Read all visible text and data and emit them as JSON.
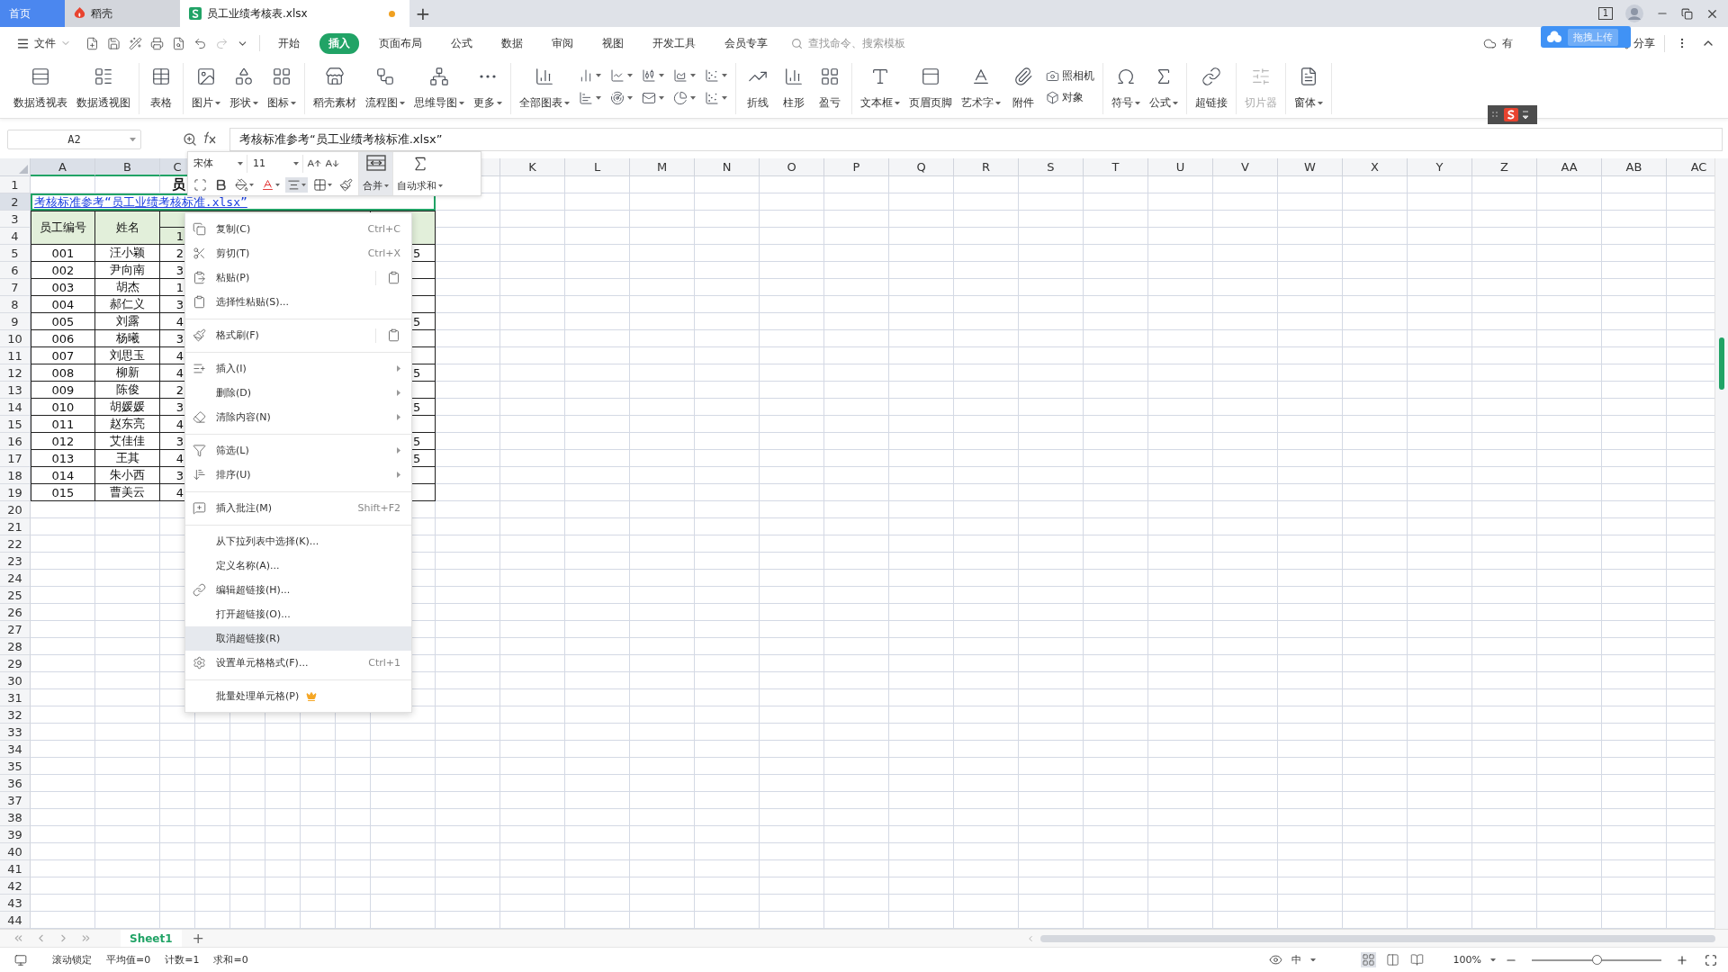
{
  "tabs": [
    {
      "label": "首页",
      "kind": "home",
      "selected": false,
      "unsaved": false
    },
    {
      "label": "稻壳",
      "kind": "docer",
      "selected": false,
      "unsaved": false
    },
    {
      "label": "员工业绩考核表.xlsx",
      "kind": "sheet",
      "selected": true,
      "unsaved": true
    }
  ],
  "new_tab": "+",
  "window_count": "1",
  "file_menu": "文件",
  "menu_tabs": [
    {
      "label": "开始",
      "selected": false
    },
    {
      "label": "插入",
      "selected": true
    },
    {
      "label": "页面布局",
      "selected": false
    },
    {
      "label": "公式",
      "selected": false
    },
    {
      "label": "数据",
      "selected": false
    },
    {
      "label": "审阅",
      "selected": false
    },
    {
      "label": "视图",
      "selected": false
    },
    {
      "label": "开发工具",
      "selected": false
    },
    {
      "label": "会员专享",
      "selected": false
    }
  ],
  "search": {
    "placeholder": "查找命令、搜索模板"
  },
  "cloud_status": "有",
  "upload_bubble": "拖拽上传",
  "share": "分享",
  "ribbon": [
    {
      "items": [
        {
          "kind": "large",
          "label": "数据透视表",
          "dropdown": false,
          "disabled": false
        },
        {
          "kind": "large",
          "label": "数据透视图",
          "dropdown": false,
          "disabled": false
        }
      ]
    },
    {
      "items": [
        {
          "kind": "large",
          "label": "表格",
          "dropdown": false,
          "disabled": false
        }
      ]
    },
    {
      "items": [
        {
          "kind": "large",
          "label": "图片",
          "dropdown": true,
          "disabled": false
        },
        {
          "kind": "large",
          "label": "形状",
          "dropdown": true,
          "disabled": false
        },
        {
          "kind": "large",
          "label": "图标",
          "dropdown": true,
          "disabled": false
        }
      ]
    },
    {
      "items": [
        {
          "kind": "large",
          "label": "稻壳素材",
          "dropdown": false,
          "disabled": false
        },
        {
          "kind": "large",
          "label": "流程图",
          "dropdown": true,
          "disabled": false
        },
        {
          "kind": "large",
          "label": "思维导图",
          "dropdown": true,
          "disabled": false
        },
        {
          "kind": "large",
          "label": "更多",
          "dropdown": true,
          "disabled": false
        }
      ]
    },
    {
      "items": [
        {
          "kind": "large",
          "label": "全部图表",
          "dropdown": true,
          "disabled": false
        },
        {
          "kind": "icon",
          "dropdown": true,
          "disabled": false
        },
        {
          "kind": "icon",
          "dropdown": true,
          "disabled": false
        },
        {
          "kind": "icon",
          "dropdown": true,
          "disabled": false
        },
        {
          "kind": "icon",
          "dropdown": true,
          "disabled": false
        },
        {
          "kind": "icon",
          "dropdown": true,
          "disabled": false
        },
        {
          "kind": "icon",
          "dropdown": true,
          "disabled": false
        },
        {
          "kind": "icon",
          "dropdown": true,
          "disabled": false
        },
        {
          "kind": "icon",
          "dropdown": true,
          "disabled": false
        },
        {
          "kind": "icon",
          "dropdown": true,
          "disabled": false
        },
        {
          "kind": "icon",
          "dropdown": true,
          "disabled": false
        }
      ]
    },
    {
      "items": [
        {
          "kind": "large",
          "label": "折线",
          "dropdown": false,
          "disabled": false
        },
        {
          "kind": "large",
          "label": "柱形",
          "dropdown": false,
          "disabled": false
        },
        {
          "kind": "large",
          "label": "盈亏",
          "dropdown": false,
          "disabled": false
        }
      ]
    },
    {
      "items": [
        {
          "kind": "large",
          "label": "文本框",
          "dropdown": true,
          "disabled": false
        },
        {
          "kind": "large",
          "label": "页眉页脚",
          "dropdown": false,
          "disabled": false
        },
        {
          "kind": "large",
          "label": "艺术字",
          "dropdown": true,
          "disabled": false
        },
        {
          "kind": "large",
          "label": "附件",
          "dropdown": false,
          "disabled": false
        },
        {
          "kind": "small",
          "label": "照相机",
          "dropdown": false,
          "disabled": false
        },
        {
          "kind": "small",
          "label": "对象",
          "dropdown": false,
          "disabled": false
        }
      ]
    },
    {
      "items": [
        {
          "kind": "large",
          "label": "符号",
          "dropdown": true,
          "disabled": false
        },
        {
          "kind": "large",
          "label": "公式",
          "dropdown": true,
          "disabled": false
        }
      ]
    },
    {
      "items": [
        {
          "kind": "large",
          "label": "超链接",
          "dropdown": false,
          "disabled": false
        }
      ]
    },
    {
      "items": [
        {
          "kind": "large",
          "label": "切片器",
          "dropdown": false,
          "disabled": true
        }
      ]
    },
    {
      "items": [
        {
          "kind": "large",
          "label": "窗体",
          "dropdown": true,
          "disabled": false
        }
      ]
    }
  ],
  "formula_bar": {
    "name_box": "A2",
    "formula": "考核标准参考“员工业绩考核标准.xlsx”"
  },
  "mini_toolbar": {
    "font": "宋体",
    "size": "11",
    "merge": {
      "label": "合并",
      "selected": true
    },
    "autosum": {
      "label": "自动求和",
      "selected": false
    },
    "format_buttons": [
      {
        "selected": false
      },
      {
        "selected": false
      },
      {
        "selected": false
      },
      {
        "selected": false
      },
      {
        "selected": true
      },
      {
        "selected": false
      },
      {
        "selected": false
      }
    ]
  },
  "sheet": {
    "column_headers": [
      {
        "label": "A",
        "selected": true
      },
      {
        "label": "B",
        "selected": true
      },
      {
        "label": "C",
        "selected": true
      },
      {
        "label": "K",
        "selected": false
      },
      {
        "label": "L",
        "selected": false
      },
      {
        "label": "M",
        "selected": false
      },
      {
        "label": "N",
        "selected": false
      },
      {
        "label": "O",
        "selected": false
      },
      {
        "label": "P",
        "selected": false
      },
      {
        "label": "Q",
        "selected": false
      },
      {
        "label": "R",
        "selected": false
      },
      {
        "label": "S",
        "selected": false
      },
      {
        "label": "T",
        "selected": false
      },
      {
        "label": "U",
        "selected": false
      },
      {
        "label": "V",
        "selected": false
      },
      {
        "label": "W",
        "selected": false
      },
      {
        "label": "X",
        "selected": false
      },
      {
        "label": "Y",
        "selected": false
      },
      {
        "label": "Z",
        "selected": false
      },
      {
        "label": "AA",
        "selected": false
      },
      {
        "label": "AB",
        "selected": false
      },
      {
        "label": "AC",
        "selected": false
      }
    ],
    "row_headers": [
      {
        "label": "1",
        "selected": false
      },
      {
        "label": "2",
        "selected": true
      },
      {
        "label": "3",
        "selected": false
      },
      {
        "label": "4",
        "selected": false
      },
      {
        "label": "5",
        "selected": false
      },
      {
        "label": "6",
        "selected": false
      },
      {
        "label": "7",
        "selected": false
      },
      {
        "label": "8",
        "selected": false
      },
      {
        "label": "9",
        "selected": false
      },
      {
        "label": "10",
        "selected": false
      },
      {
        "label": "11",
        "selected": false
      },
      {
        "label": "12",
        "selected": false
      },
      {
        "label": "13",
        "selected": false
      },
      {
        "label": "14",
        "selected": false
      },
      {
        "label": "15",
        "selected": false
      },
      {
        "label": "16",
        "selected": false
      },
      {
        "label": "17",
        "selected": false
      },
      {
        "label": "18",
        "selected": false
      },
      {
        "label": "19",
        "selected": false
      },
      {
        "label": "20",
        "selected": false
      },
      {
        "label": "21",
        "selected": false
      },
      {
        "label": "22",
        "selected": false
      },
      {
        "label": "23",
        "selected": false
      },
      {
        "label": "24",
        "selected": false
      },
      {
        "label": "25",
        "selected": false
      },
      {
        "label": "26",
        "selected": false
      },
      {
        "label": "27",
        "selected": false
      },
      {
        "label": "28",
        "selected": false
      },
      {
        "label": "29",
        "selected": false
      },
      {
        "label": "30",
        "selected": false
      },
      {
        "label": "31",
        "selected": false
      },
      {
        "label": "32",
        "selected": false
      },
      {
        "label": "33",
        "selected": false
      },
      {
        "label": "34",
        "selected": false
      },
      {
        "label": "35",
        "selected": false
      },
      {
        "label": "36",
        "selected": false
      },
      {
        "label": "37",
        "selected": false
      },
      {
        "label": "38",
        "selected": false
      },
      {
        "label": "39",
        "selected": false
      },
      {
        "label": "40",
        "selected": false
      },
      {
        "label": "41",
        "selected": false
      },
      {
        "label": "42",
        "selected": false
      },
      {
        "label": "43",
        "selected": false
      },
      {
        "label": "44",
        "selected": false
      }
    ],
    "title": "员",
    "link": "考核标准参考“员工业绩考核标准.xlsx”",
    "header": {
      "employee_id": "员工编号",
      "name": "姓名",
      "column_3": "1"
    },
    "rows": [
      {
        "employee_id": "001",
        "name": "汪小颖",
        "column_3": "2",
        "column_9": "5"
      },
      {
        "employee_id": "002",
        "name": "尹向南",
        "column_3": "3"
      },
      {
        "employee_id": "003",
        "name": "胡杰",
        "column_3": "1"
      },
      {
        "employee_id": "004",
        "name": "郝仁义",
        "column_3": "3"
      },
      {
        "employee_id": "005",
        "name": "刘露",
        "column_3": "4",
        "column_9": "5"
      },
      {
        "employee_id": "006",
        "name": "杨曦",
        "column_3": "3"
      },
      {
        "employee_id": "007",
        "name": "刘思玉",
        "column_3": "4"
      },
      {
        "employee_id": "008",
        "name": "柳新",
        "column_3": "4",
        "column_9": "5"
      },
      {
        "employee_id": "009",
        "name": "陈俊",
        "column_3": "2"
      },
      {
        "employee_id": "010",
        "name": "胡媛媛",
        "column_3": "3",
        "column_9": "5"
      },
      {
        "employee_id": "011",
        "name": "赵东亮",
        "column_3": "4"
      },
      {
        "employee_id": "012",
        "name": "艾佳佳",
        "column_3": "3",
        "column_9": "5"
      },
      {
        "employee_id": "013",
        "name": "王其",
        "column_3": "4",
        "column_9": "5"
      },
      {
        "employee_id": "014",
        "name": "朱小西",
        "column_3": "3"
      },
      {
        "employee_id": "015",
        "name": "曹美云",
        "column_3": "4"
      }
    ]
  },
  "context_menu": {
    "groups": [
      [
        {
          "label": "复制(C)",
          "shortcut": "Ctrl+C",
          "submenu": false,
          "selected": false
        },
        {
          "label": "剪切(T)",
          "shortcut": "Ctrl+X",
          "submenu": false,
          "selected": false
        },
        {
          "label": "粘贴(P)",
          "submenu": false,
          "side_button": true,
          "selected": false
        },
        {
          "label": "选择性粘贴(S)...",
          "submenu": false,
          "selected": false
        }
      ],
      [
        {
          "label": "格式刷(F)",
          "submenu": false,
          "side_button": true,
          "selected": false
        }
      ],
      [
        {
          "label": "插入(I)",
          "submenu": true,
          "selected": false
        },
        {
          "label": "删除(D)",
          "submenu": true,
          "selected": false
        },
        {
          "label": "清除内容(N)",
          "submenu": true,
          "selected": false
        }
      ],
      [
        {
          "label": "筛选(L)",
          "submenu": true,
          "selected": false
        },
        {
          "label": "排序(U)",
          "submenu": true,
          "selected": false
        }
      ],
      [
        {
          "label": "插入批注(M)",
          "shortcut": "Shift+F2",
          "submenu": false,
          "selected": false
        }
      ],
      [
        {
          "label": "从下拉列表中选择(K)...",
          "submenu": false,
          "selected": false
        },
        {
          "label": "定义名称(A)...",
          "submenu": false,
          "selected": false
        },
        {
          "label": "编辑超链接(H)...",
          "submenu": false,
          "selected": false
        },
        {
          "label": "打开超链接(O)...",
          "submenu": false,
          "selected": false
        },
        {
          "label": "取消超链接(R)",
          "submenu": false,
          "selected": true
        },
        {
          "label": "设置单元格格式(F)...",
          "shortcut": "Ctrl+1",
          "submenu": false,
          "selected": false
        }
      ],
      [
        {
          "label": "批量处理单元格(P)",
          "submenu": false,
          "premium": true,
          "selected": false
        }
      ]
    ]
  },
  "sheet_tabs": [
    {
      "label": "Sheet1",
      "selected": true
    }
  ],
  "add_sheet": "+",
  "status_bar": {
    "scroll_lock": "滚动锁定",
    "stats": [
      "平均值=0",
      "计数=1",
      "求和=0"
    ],
    "input_mode": "中",
    "views": [
      {
        "selected": true
      },
      {
        "selected": false
      },
      {
        "selected": false
      }
    ],
    "zoom": "100%",
    "zoom_level": {
      "level": 0.5
    }
  }
}
